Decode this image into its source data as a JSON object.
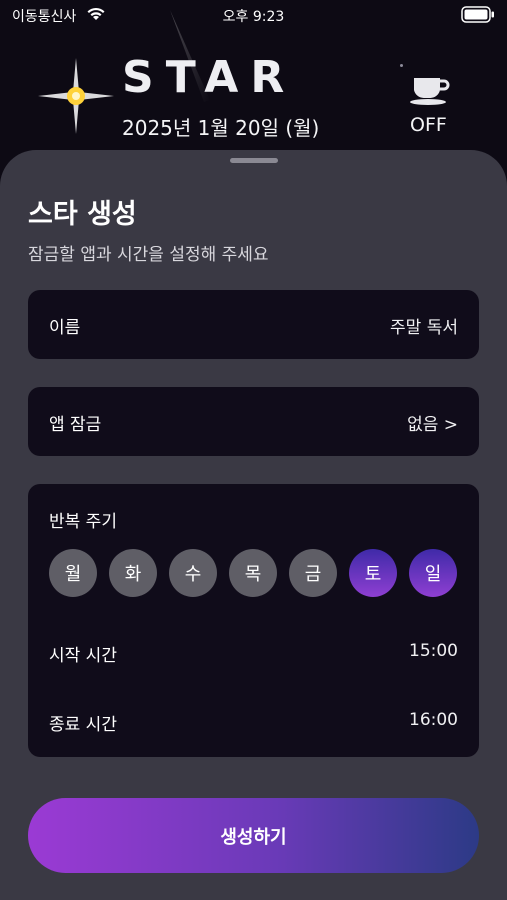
{
  "status_bar": {
    "carrier": "이동통신사",
    "time": "오후 9:23"
  },
  "header": {
    "logo": "STAR",
    "date": "2025년 1월 20일 (월)",
    "break_label": "OFF"
  },
  "sheet": {
    "title": "스타 생성",
    "subtitle": "잠금할 앱과 시간을 설정해 주세요",
    "name_row": {
      "label": "이름",
      "value": "주말 독서"
    },
    "app_lock_row": {
      "label": "앱 잠금",
      "value": "없음 >"
    },
    "repeat": {
      "label": "반복 주기",
      "days": [
        {
          "label": "월",
          "selected": false
        },
        {
          "label": "화",
          "selected": false
        },
        {
          "label": "수",
          "selected": false
        },
        {
          "label": "목",
          "selected": false
        },
        {
          "label": "금",
          "selected": false
        },
        {
          "label": "토",
          "selected": true
        },
        {
          "label": "일",
          "selected": true
        }
      ]
    },
    "start_time": {
      "label": "시작 시간",
      "value": "15:00"
    },
    "end_time": {
      "label": "종료 시간",
      "value": "16:00"
    },
    "create_button": "생성하기"
  },
  "colors": {
    "accent_start": "#9b3ad4",
    "accent_end": "#2c3a86",
    "sheet": "#3a3944",
    "card": "#100c1a"
  }
}
